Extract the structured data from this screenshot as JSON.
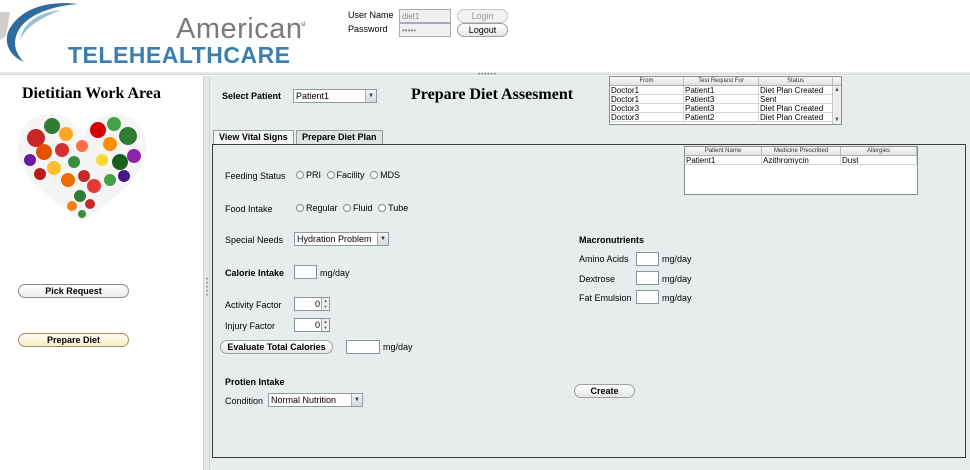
{
  "brand": {
    "american": "American",
    "sl": "sl",
    "tele": "TELE",
    "healthcare": "HEALTHCARE"
  },
  "login": {
    "username_label": "User Name",
    "password_label": "Password",
    "username_value": "diet1",
    "password_value": "•••••",
    "login_button": "Login",
    "logout_button": "Logout"
  },
  "sidebar": {
    "title": "Dietitian Work Area",
    "pick_request": "Pick Request",
    "prepare_diet": "Prepare Diet"
  },
  "main": {
    "select_patient_label": "Select Patient",
    "select_patient_value": "Patient1",
    "page_title": "Prepare Diet Assesment"
  },
  "requests_table": {
    "columns": [
      "From",
      "Test Request For",
      "Status"
    ],
    "rows": [
      [
        "Doctor1",
        "Patient1",
        "Diet Plan Created"
      ],
      [
        "Doctor1",
        "Patient3",
        "Sent"
      ],
      [
        "Doctor3",
        "Patient3",
        "Diet Plan Created"
      ],
      [
        "Doctor3",
        "Patient2",
        "Diet Plan Created"
      ]
    ]
  },
  "tabs": {
    "vital_signs": "View Vital Signs",
    "diet_plan": "Prepare Diet Plan"
  },
  "patient_table": {
    "columns": [
      "Patient Name",
      "Medicine Prescribed",
      "Allergies"
    ],
    "rows": [
      [
        "Patient1",
        "Azithromycin",
        "Dust"
      ]
    ]
  },
  "form": {
    "feeding_status_label": "Feeding Status",
    "feeding_options": [
      "PRI",
      "Facility",
      "MDS"
    ],
    "food_intake_label": "Food Intake",
    "food_options": [
      "Regular",
      "Fluid",
      "Tube"
    ],
    "special_needs_label": "Special Needs",
    "special_needs_value": "Hydration Problem",
    "calorie_intake_label": "Calorie Intake",
    "unit": "mg/day",
    "activity_factor_label": "Activity Factor",
    "activity_factor_value": "0",
    "injury_factor_label": "Injury Factor",
    "injury_factor_value": "0",
    "evaluate_button": "Evaluate Total Calories",
    "protein_intake_label": "Protien Intake",
    "condition_label": "Condition",
    "condition_value": "Normal Nutrition",
    "macronutrients_label": "Macronutrients",
    "amino_acids_label": "Amino Acids",
    "dextrose_label": "Dextrose",
    "fat_emulsion_label": "Fat Emulsion",
    "create_button": "Create"
  },
  "colors": {
    "brand_blue": "#3a7fb0",
    "panel_bg": "#e7ecec"
  }
}
